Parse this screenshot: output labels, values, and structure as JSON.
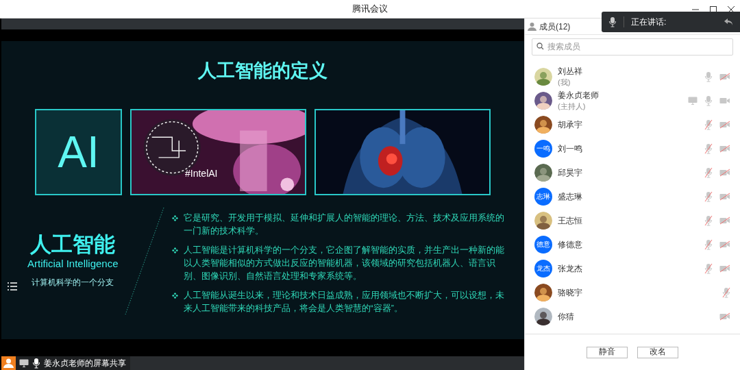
{
  "window": {
    "title": "腾讯会议"
  },
  "speaking": {
    "label": "正在讲话:"
  },
  "slide": {
    "title": "人工智能的定义",
    "ai_box": "AI",
    "image_tag": "#IntelAI",
    "heading": "人工智能",
    "heading_en": "Artificial Intelligence",
    "subheading": "计算机科学的一个分支",
    "bullets": [
      "它是研究、开发用于模拟、延伸和扩展人的智能的理论、方法、技术及应用系统的一门新的技术科学。",
      "人工智能是计算机科学的一个分支，它企图了解智能的实质，并生产出一种新的能以人类智能相似的方式做出反应的智能机器，该领域的研究包括机器人、语言识别、图像识别、自然语言处理和专家系统等。",
      "人工智能从诞生以来，理论和技术日益成熟，应用领域也不断扩大，可以设想，未来人工智能带来的科技产品，将会是人类智慧的“容器”。"
    ]
  },
  "share_bar": {
    "label": "姜永贞老师的屏幕共享"
  },
  "members": {
    "title": "成员(12)",
    "search": {
      "placeholder": "搜索成员"
    },
    "items": [
      {
        "name": "刘丛祥",
        "note": "(我)",
        "mic_muted": false,
        "camera_off": true
      },
      {
        "name": "姜永贞老师",
        "note": "(主持人)",
        "sharing": true,
        "mic_muted": false,
        "camera_off": false
      },
      {
        "name": "胡承宇",
        "mic_muted": true,
        "camera_off": true
      },
      {
        "name": "刘一鸣",
        "avatar": {
          "kind": "initials",
          "text": "一鸣"
        },
        "mic_muted": true,
        "camera_off": true
      },
      {
        "name": "邱昊宇",
        "mic_muted": true,
        "camera_off": true
      },
      {
        "name": "盛志琳",
        "avatar": {
          "kind": "initials",
          "text": "志琳"
        },
        "mic_muted": true,
        "camera_off": true
      },
      {
        "name": "王志恒",
        "mic_muted": true,
        "camera_off": true
      },
      {
        "name": "修德意",
        "avatar": {
          "kind": "initials",
          "text": "德意"
        },
        "mic_muted": true,
        "camera_off": true
      },
      {
        "name": "张龙杰",
        "avatar": {
          "kind": "initials",
          "text": "龙杰"
        },
        "mic_muted": true,
        "camera_off": true
      },
      {
        "name": "骆晓宇",
        "mic_muted": true
      },
      {
        "name": "你猜",
        "camera_off": true
      }
    ],
    "buttons": [
      "静音",
      "改名"
    ]
  }
}
